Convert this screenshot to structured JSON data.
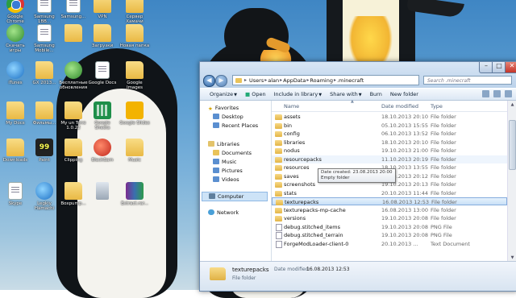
{
  "desktop": {
    "icons": [
      {
        "label": "Google Chrome",
        "icon": "chrome-icon"
      },
      {
        "label": "Samsung 1BB...",
        "icon": "doc-icon"
      },
      {
        "label": "Samsung...",
        "icon": "doc-icon"
      },
      {
        "label": "VPN",
        "icon": "folder-icon"
      },
      {
        "label": "Сервер Хамачи",
        "icon": "folder-icon"
      },
      {
        "label": "Скачать игры",
        "icon": "green-icon"
      },
      {
        "label": "Samsung Mobile...",
        "icon": "doc-icon"
      },
      {
        "label": "",
        "icon": "folder-icon"
      },
      {
        "label": "Загрузки",
        "icon": "folder-icon"
      },
      {
        "label": "Новая папка",
        "icon": "folder-icon"
      },
      {
        "label": "iTunes",
        "icon": "app-icon"
      },
      {
        "label": "GX 2013...",
        "icon": "folder-icon"
      },
      {
        "label": "Бесплатные обновления",
        "icon": "green-icon"
      },
      {
        "label": "Google Docs",
        "icon": "doc-icon"
      },
      {
        "label": "Google Images",
        "icon": "folder-icon"
      },
      {
        "label": "My Docs",
        "icon": "folder-icon"
      },
      {
        "label": "Фильмы...",
        "icon": "folder-icon"
      },
      {
        "label": "My un Tone 1.0.22",
        "icon": "folder-icon"
      },
      {
        "label": "Google Sheets",
        "icon": "sheet-icon"
      },
      {
        "label": "Google Slides",
        "icon": "slides-icon"
      },
      {
        "label": "Downloads",
        "icon": "folder-icon"
      },
      {
        "label": "Paint",
        "icon": "dark-icon"
      },
      {
        "label": "Clipping",
        "icon": "folder-icon"
      },
      {
        "label": "BlackSam",
        "icon": "red-icon"
      },
      {
        "label": "Music",
        "icon": "folder-icon"
      },
      {
        "label": "Skype",
        "icon": "doc-icon"
      },
      {
        "label": "Legkiy Hamachi",
        "icon": "app-icon"
      },
      {
        "label": "Boxpump...",
        "icon": "folder-icon"
      },
      {
        "label": "",
        "icon": "bin-icon"
      },
      {
        "label": "Extract.rar...",
        "icon": "rar-icon"
      }
    ]
  },
  "window": {
    "address": [
      "Users",
      "alan",
      "AppData",
      "Roaming",
      ".minecraft"
    ],
    "search_placeholder": "Search .minecraft",
    "toolbar": [
      "Organize",
      "Open",
      "Include in library",
      "Share with",
      "Burn",
      "New folder"
    ],
    "nav": {
      "favorites": "Favorites",
      "favorites_items": [
        "Desktop",
        "Recent Places"
      ],
      "libraries": "Libraries",
      "libraries_items": [
        "Documents",
        "Music",
        "Pictures",
        "Videos"
      ],
      "computer": "Computer",
      "network": "Network"
    },
    "columns": {
      "name": "Name",
      "date": "Date modified",
      "type": "Type"
    },
    "files": [
      {
        "name": "assets",
        "date": "18.10.2013 20:10",
        "type": "File folder",
        "kind": "folder"
      },
      {
        "name": "bin",
        "date": "05.10.2013 15:55",
        "type": "File folder",
        "kind": "folder"
      },
      {
        "name": "config",
        "date": "06.10.2013 13:52",
        "type": "File folder",
        "kind": "folder"
      },
      {
        "name": "libraries",
        "date": "18.10.2013 20:10",
        "type": "File folder",
        "kind": "folder"
      },
      {
        "name": "nodus",
        "date": "19.10.2013 21:00",
        "type": "File folder",
        "kind": "folder"
      },
      {
        "name": "resourcepacks",
        "date": "11.10.2013 20:19",
        "type": "File folder",
        "kind": "folder"
      },
      {
        "name": "resources",
        "date": "18.10.2013 13:55",
        "type": "File folder",
        "kind": "folder"
      },
      {
        "name": "saves",
        "date": "19.10.2013 20:12",
        "type": "File folder",
        "kind": "folder"
      },
      {
        "name": "screenshots",
        "date": "19.10.2013 20:13",
        "type": "File folder",
        "kind": "folder"
      },
      {
        "name": "stats",
        "date": "20.10.2013 11:44",
        "type": "File folder",
        "kind": "folder"
      },
      {
        "name": "texturepacks",
        "date": "16.08.2013 12:53",
        "type": "File folder",
        "kind": "folder"
      },
      {
        "name": "texturepacks-mp-cache",
        "date": "16.08.2013 13:00",
        "type": "File folder",
        "kind": "folder"
      },
      {
        "name": "versions",
        "date": "19.10.2013 20:08",
        "type": "File folder",
        "kind": "folder"
      },
      {
        "name": "debug.stitched_items",
        "date": "19.10.2013 20:08",
        "type": "PNG File",
        "kind": "file"
      },
      {
        "name": "debug.stitched_terrain",
        "date": "19.10.2013 20:08",
        "type": "PNG File",
        "kind": "file"
      },
      {
        "name": "ForgeModLoader-client-0",
        "date": "20.10.2013 ...",
        "type": "Text Document",
        "kind": "file"
      }
    ],
    "selected_index": 10,
    "hover_index": 5,
    "tooltip": {
      "line1": "Date created: 23.08.2013 20:00",
      "line2": "Empty folder"
    },
    "details": {
      "name": "texturepacks",
      "date_label": "Date modified:",
      "date_value": "16.08.2013 12:53",
      "type": "File folder"
    }
  }
}
